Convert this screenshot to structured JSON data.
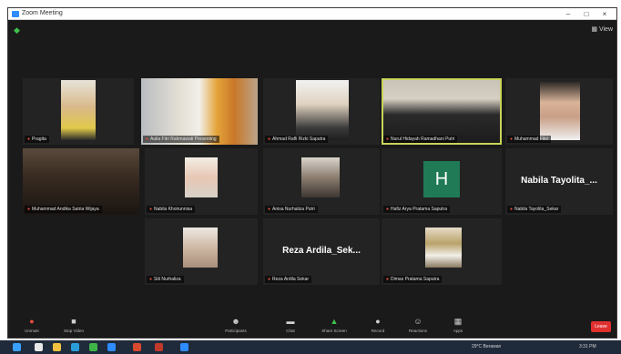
{
  "window": {
    "title": "Zoom Meeting",
    "controls": [
      "–",
      "□",
      "×"
    ],
    "view_label": "View"
  },
  "participants": [
    {
      "name": "Pragita"
    },
    {
      "name": "Aulia Fitri Rahmawati Presenting"
    },
    {
      "name": "Ahmad Rafli Rizki Saputra"
    },
    {
      "name": "Nurul Hidayah Ramadhani Putri"
    },
    {
      "name": "Muhammad Fikri"
    },
    {
      "name": "Muhammad Andika Satria Wijaya"
    },
    {
      "name": "Nabila Khoirunnisa"
    },
    {
      "name": "Anisa Nurhaliza Putri"
    },
    {
      "name": "Hafiz Arya Pratama Saputra"
    },
    {
      "name": "Nabila Tayolita_Sekar",
      "display": "Nabila  Tayolita_..."
    },
    {
      "name": "Siti Nurhaliza"
    },
    {
      "name": "Reza Ardila Sekar",
      "display": "Reza  Ardila_Sek..."
    },
    {
      "name": "Dimas Pratama Saputra"
    }
  ],
  "avatar_letter": "H",
  "toolbar": {
    "items": [
      {
        "label": "Unmute",
        "icon": "mic-off-icon"
      },
      {
        "label": "Stop Video",
        "icon": "video-icon"
      },
      {
        "label": "Participants",
        "icon": "participants-icon"
      },
      {
        "label": "Chat",
        "icon": "chat-icon"
      },
      {
        "label": "Share Screen",
        "icon": "share-screen-icon"
      },
      {
        "label": "Record",
        "icon": "record-icon"
      },
      {
        "label": "Reactions",
        "icon": "reactions-icon"
      },
      {
        "label": "Apps",
        "icon": "apps-icon"
      }
    ],
    "leave_label": "Leave"
  },
  "taskbar": {
    "weather": "29°C Berawan",
    "time": "3:31 PM"
  },
  "colors": {
    "zoom_blue": "#2d8cff",
    "active_border": "#c9d45a",
    "leave_red": "#e02f2f",
    "avatar_green": "#1f7a55"
  }
}
